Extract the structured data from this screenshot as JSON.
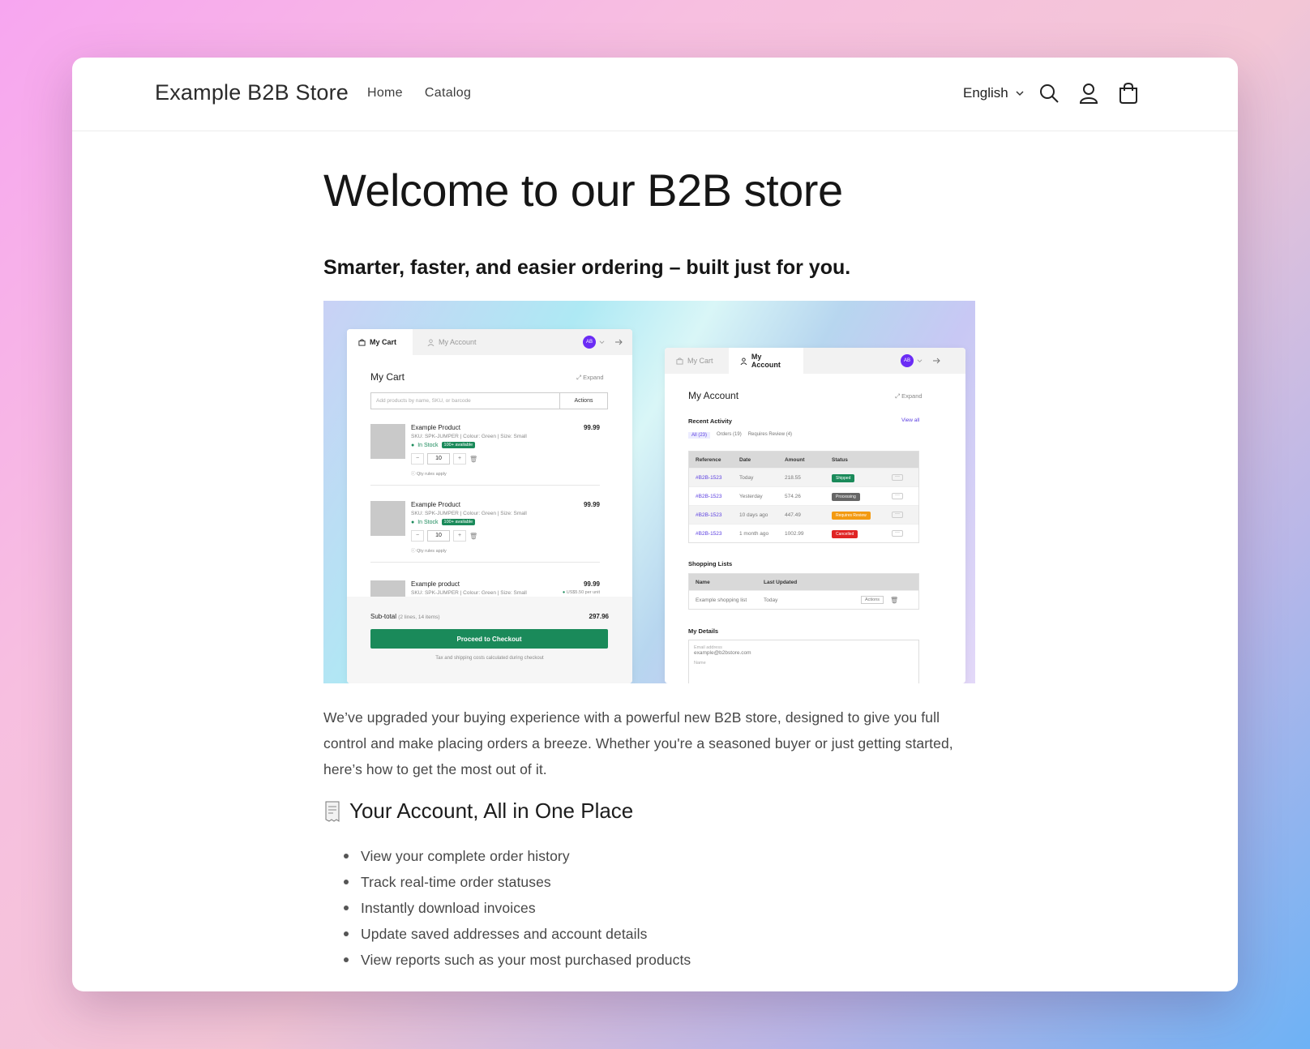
{
  "brand": "Example B2B Store",
  "nav": [
    "Home",
    "Catalog"
  ],
  "language": "English",
  "title": "Welcome to our B2B store",
  "subtitle": "Smarter, faster, and easier ordering – built just for you.",
  "intro": "We’ve upgraded your buying experience with a powerful new B2B store, designed to give you full control and make placing orders a breeze. Whether you're a seasoned buyer or just getting started, here’s how to get the most out of it.",
  "section_title": "Your Account, All in One Place",
  "bullets": [
    "View your complete order history",
    "Track real-time order statuses",
    "Instantly download invoices",
    "Update saved addresses and account details",
    "View reports such as your most purchased products"
  ],
  "mock_cart": {
    "tab_cart": "My Cart",
    "tab_account": "My Account",
    "avatar": "AB",
    "title": "My Cart",
    "expand": "Expand",
    "search_placeholder": "Add products by name, SKU, or barcode",
    "actions": "Actions",
    "products": [
      {
        "name": "Example Product",
        "sku": "SKU: SPK-JUMPER | Colour: Green | Size: Small",
        "price": "99.99",
        "stock": "In Stock",
        "avail": "100+ available",
        "qty": "10",
        "rule": "Qty rules apply"
      },
      {
        "name": "Example Product",
        "sku": "SKU: SPK-JUMPER | Colour: Green | Size: Small",
        "price": "99.99",
        "stock": "In Stock",
        "avail": "100+ available",
        "qty": "10",
        "rule": "Qty rules apply"
      },
      {
        "name": "Example product",
        "sku": "SKU: SPK-JUMPER | Colour: Green | Size: Small",
        "price": "99.99",
        "unit": "US$5.50 per unit"
      }
    ],
    "subtotal_label": "Sub-total",
    "subtotal_detail": "(2 lines, 14 items)",
    "subtotal_value": "297.96",
    "checkout": "Proceed to Checkout",
    "note": "Tax and shipping costs calculated during checkout"
  },
  "mock_account": {
    "tab_cart": "My Cart",
    "tab_account": "My Account",
    "avatar": "AB",
    "title": "My Account",
    "expand": "Expand",
    "recent": "Recent Activity",
    "view_all": "View all",
    "filters": [
      "All (23)",
      "Orders (19)",
      "Requires Review (4)"
    ],
    "columns": [
      "Reference",
      "Date",
      "Amount",
      "Status"
    ],
    "rows": [
      {
        "ref": "#B2B-1523",
        "date": "Today",
        "amount": "218.55",
        "status": "Shipped",
        "color": "#1a8a5a"
      },
      {
        "ref": "#B2B-1523",
        "date": "Yesterday",
        "amount": "574.26",
        "status": "Processing",
        "color": "#666666"
      },
      {
        "ref": "#B2B-1523",
        "date": "10 days ago",
        "amount": "447.49",
        "status": "Requires Review",
        "color": "#f39a12"
      },
      {
        "ref": "#B2B-1523",
        "date": "1 month ago",
        "amount": "1002.99",
        "status": "Cancelled",
        "color": "#e02424"
      }
    ],
    "lists_title": "Shopping Lists",
    "lists_columns": [
      "Name",
      "Last Updated"
    ],
    "list_row": {
      "name": "Example shopping list",
      "updated": "Today",
      "actions": "Actions"
    },
    "details_title": "My Details",
    "email_label": "Email address",
    "email_value": "example@b2bstore.com",
    "name_label": "Name"
  },
  "colors": {
    "accent_green": "#1a8a5a",
    "avatar_purple": "#6b2cf5",
    "link_purple": "#5b3ee0"
  }
}
